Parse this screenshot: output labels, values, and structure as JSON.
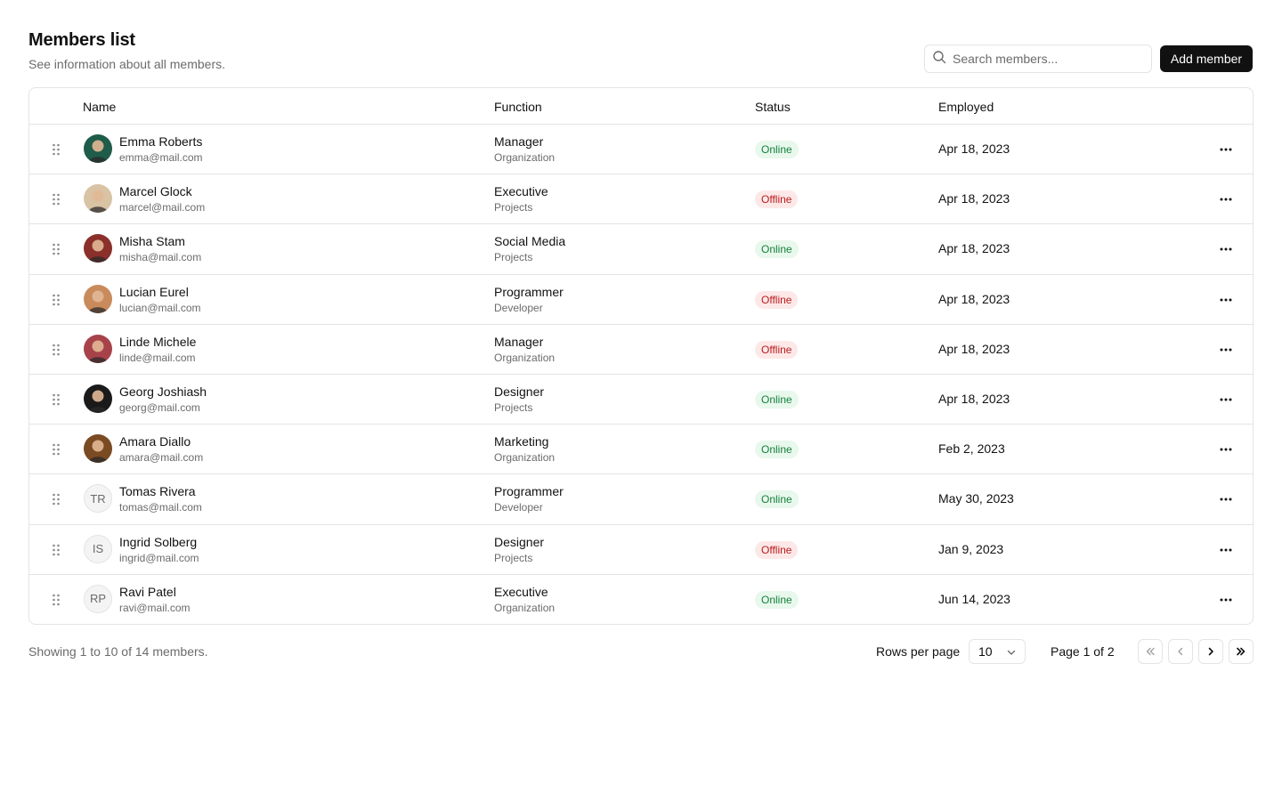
{
  "header": {
    "title": "Members list",
    "subtitle": "See information about all members."
  },
  "search": {
    "placeholder": "Search members..."
  },
  "add_button": "Add member",
  "columns": {
    "name": "Name",
    "function": "Function",
    "status": "Status",
    "employed": "Employed"
  },
  "colors": {
    "online_bg": "#e8f8ec",
    "online_text": "#15803d",
    "offline_bg": "#fde8e8",
    "offline_text": "#b91c1c",
    "primary": "#111111"
  },
  "members": [
    {
      "name": "Emma Roberts",
      "email": "emma@mail.com",
      "function": "Manager",
      "dept": "Organization",
      "status": "Online",
      "employed": "Apr 18, 2023",
      "avatar": "photo",
      "avatar_color": "#1f5c4a"
    },
    {
      "name": "Marcel Glock",
      "email": "marcel@mail.com",
      "function": "Executive",
      "dept": "Projects",
      "status": "Offline",
      "employed": "Apr 18, 2023",
      "avatar": "photo",
      "avatar_color": "#d9c3a5"
    },
    {
      "name": "Misha Stam",
      "email": "misha@mail.com",
      "function": "Social Media",
      "dept": "Projects",
      "status": "Online",
      "employed": "Apr 18, 2023",
      "avatar": "photo",
      "avatar_color": "#8a2f2a"
    },
    {
      "name": "Lucian Eurel",
      "email": "lucian@mail.com",
      "function": "Programmer",
      "dept": "Developer",
      "status": "Offline",
      "employed": "Apr 18, 2023",
      "avatar": "photo",
      "avatar_color": "#c98a5c"
    },
    {
      "name": "Linde Michele",
      "email": "linde@mail.com",
      "function": "Manager",
      "dept": "Organization",
      "status": "Offline",
      "employed": "Apr 18, 2023",
      "avatar": "photo",
      "avatar_color": "#a8424a"
    },
    {
      "name": "Georg Joshiash",
      "email": "georg@mail.com",
      "function": "Designer",
      "dept": "Projects",
      "status": "Online",
      "employed": "Apr 18, 2023",
      "avatar": "photo",
      "avatar_color": "#1a1a1a"
    },
    {
      "name": "Amara Diallo",
      "email": "amara@mail.com",
      "function": "Marketing",
      "dept": "Organization",
      "status": "Online",
      "employed": "Feb 2, 2023",
      "avatar": "photo",
      "avatar_color": "#7a4a22"
    },
    {
      "name": "Tomas Rivera",
      "email": "tomas@mail.com",
      "function": "Programmer",
      "dept": "Developer",
      "status": "Online",
      "employed": "May 30, 2023",
      "avatar": "initials",
      "initials": "TR"
    },
    {
      "name": "Ingrid Solberg",
      "email": "ingrid@mail.com",
      "function": "Designer",
      "dept": "Projects",
      "status": "Offline",
      "employed": "Jan 9, 2023",
      "avatar": "initials",
      "initials": "IS"
    },
    {
      "name": "Ravi Patel",
      "email": "ravi@mail.com",
      "function": "Executive",
      "dept": "Organization",
      "status": "Online",
      "employed": "Jun 14, 2023",
      "avatar": "initials",
      "initials": "RP"
    }
  ],
  "footer": {
    "showing": "Showing 1 to 10 of 14 members.",
    "rows_per_page_label": "Rows per page",
    "rows_per_page_value": "10",
    "page_label": "Page 1 of 2"
  },
  "icons": {
    "search": "search-icon",
    "drag": "grip-vertical-icon",
    "more": "more-horizontal-icon",
    "chevron_down": "chevron-down-icon",
    "first": "chevrons-left-icon",
    "prev": "chevron-left-icon",
    "next": "chevron-right-icon",
    "last": "chevrons-right-icon"
  }
}
